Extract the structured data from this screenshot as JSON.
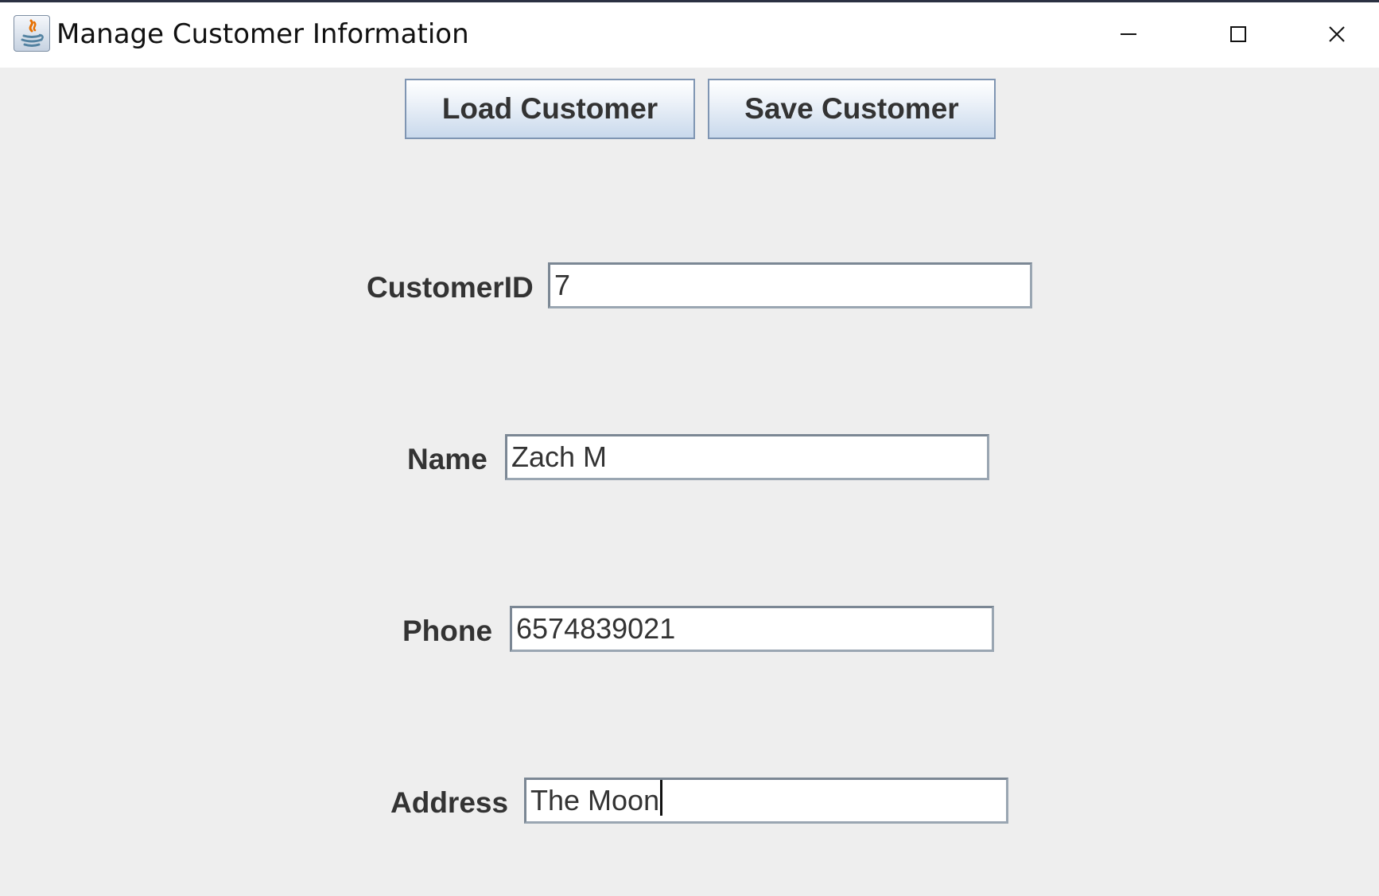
{
  "window": {
    "title": "Manage Customer Information",
    "app_icon": "java-icon",
    "controls": {
      "minimize": "minimize-icon",
      "maximize": "maximize-icon",
      "close": "close-icon"
    }
  },
  "toolbar": {
    "load_label": "Load Customer",
    "save_label": "Save Customer"
  },
  "form": {
    "customer_id": {
      "label": "CustomerID",
      "value": "7"
    },
    "name": {
      "label": "Name",
      "value": "Zach M"
    },
    "phone": {
      "label": "Phone",
      "value": "6574839021"
    },
    "address": {
      "label": "Address",
      "value": "The Moon"
    }
  },
  "colors": {
    "panel_background": "#eeeeee",
    "button_gradient_top": "#ffffff",
    "button_gradient_bottom": "#c9d9ec",
    "button_border": "#7f95b2",
    "text": "#333333"
  }
}
